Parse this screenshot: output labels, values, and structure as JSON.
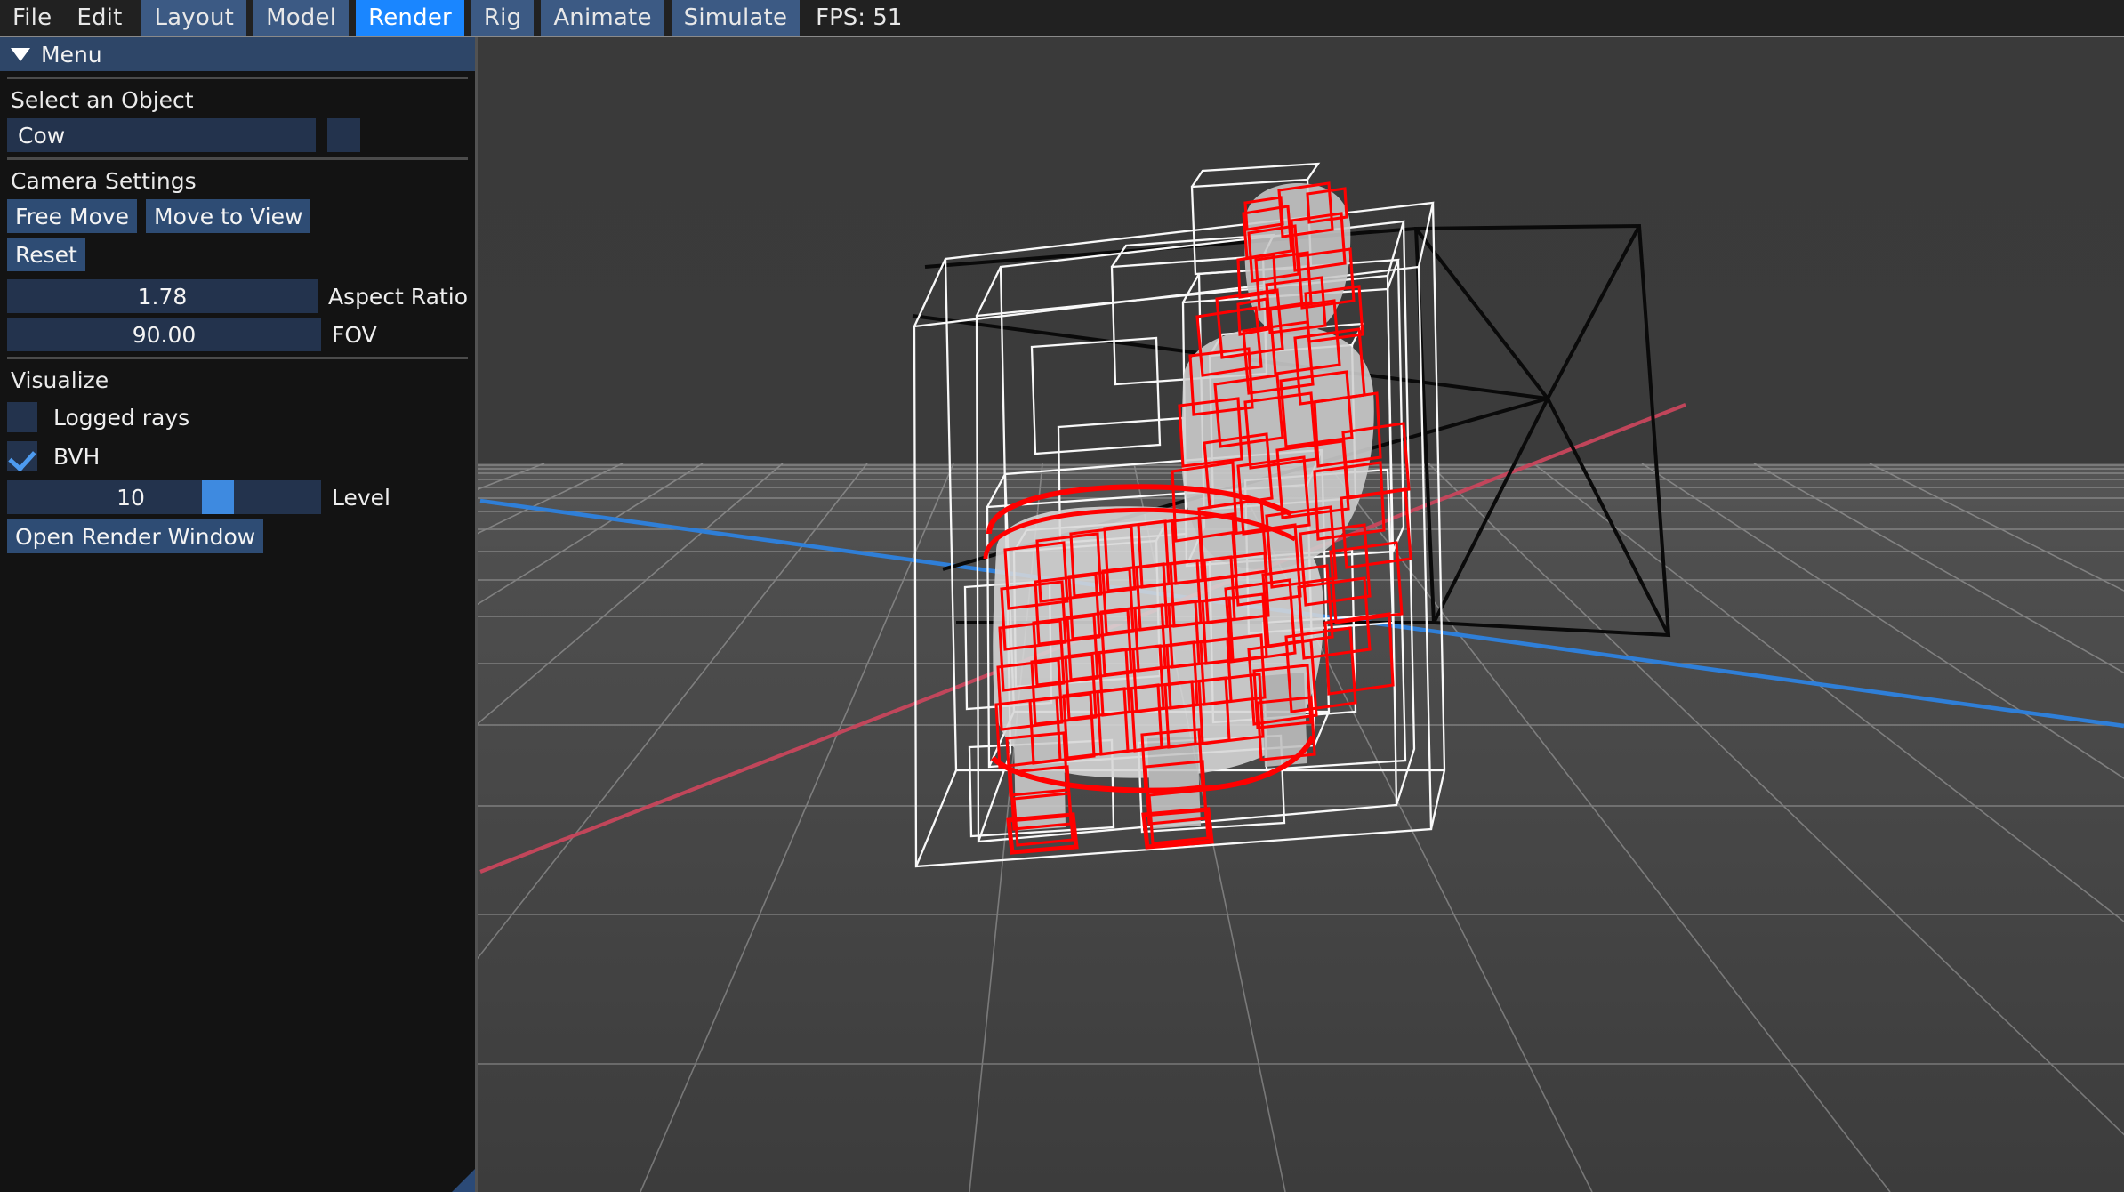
{
  "menubar": {
    "items": [
      {
        "label": "File",
        "style": "plain",
        "name": "menu-file"
      },
      {
        "label": "Edit",
        "style": "plain",
        "name": "menu-edit"
      },
      {
        "label": "Layout",
        "style": "shaded",
        "name": "menu-layout"
      },
      {
        "label": "Model",
        "style": "shaded",
        "name": "menu-model"
      },
      {
        "label": "Render",
        "style": "active",
        "name": "menu-render"
      },
      {
        "label": "Rig",
        "style": "shaded",
        "name": "menu-rig"
      },
      {
        "label": "Animate",
        "style": "shaded",
        "name": "menu-animate"
      },
      {
        "label": "Simulate",
        "style": "shaded",
        "name": "menu-simulate"
      }
    ],
    "fps_text": "FPS: 51",
    "active_item": "Render",
    "accent_color": "#1a86ff"
  },
  "panel": {
    "title": "Menu",
    "collapse_icon": "triangle-down-icon",
    "select_object": {
      "label": "Select an Object",
      "value": "Cow",
      "placeholder": "Cow"
    },
    "camera_settings": {
      "label": "Camera Settings",
      "buttons": [
        {
          "label": "Free Move",
          "name": "free-move-button"
        },
        {
          "label": "Move to View",
          "name": "move-to-view-button"
        },
        {
          "label": "Reset",
          "name": "reset-camera-button"
        }
      ],
      "aspect_ratio": {
        "value": "1.78",
        "label": "Aspect Ratio",
        "fill_pct": 0
      },
      "fov": {
        "value": "90.00",
        "label": "FOV",
        "fill_pct": 0
      }
    },
    "visualize": {
      "label": "Visualize",
      "checkboxes": [
        {
          "label": "Logged rays",
          "checked": false,
          "name": "logged-rays-checkbox"
        },
        {
          "label": "BVH",
          "checked": true,
          "name": "bvh-checkbox"
        }
      ],
      "level": {
        "value": "10",
        "label": "Level",
        "handle_pct": 62
      },
      "open_render_window": "Open Render Window"
    }
  },
  "viewport": {
    "sky_color": "#3b3b3b",
    "ground_color": "#4a4a4a",
    "grid_color": "#9a9a9a",
    "axis_x_color": "#d04a5a",
    "axis_z_color": "#2f7fd8",
    "bvh_color": "#ff0000",
    "bounds_color": "#ffffff",
    "frustum_color": "#000000",
    "object_name": "Cow",
    "bvh_level": "10"
  }
}
